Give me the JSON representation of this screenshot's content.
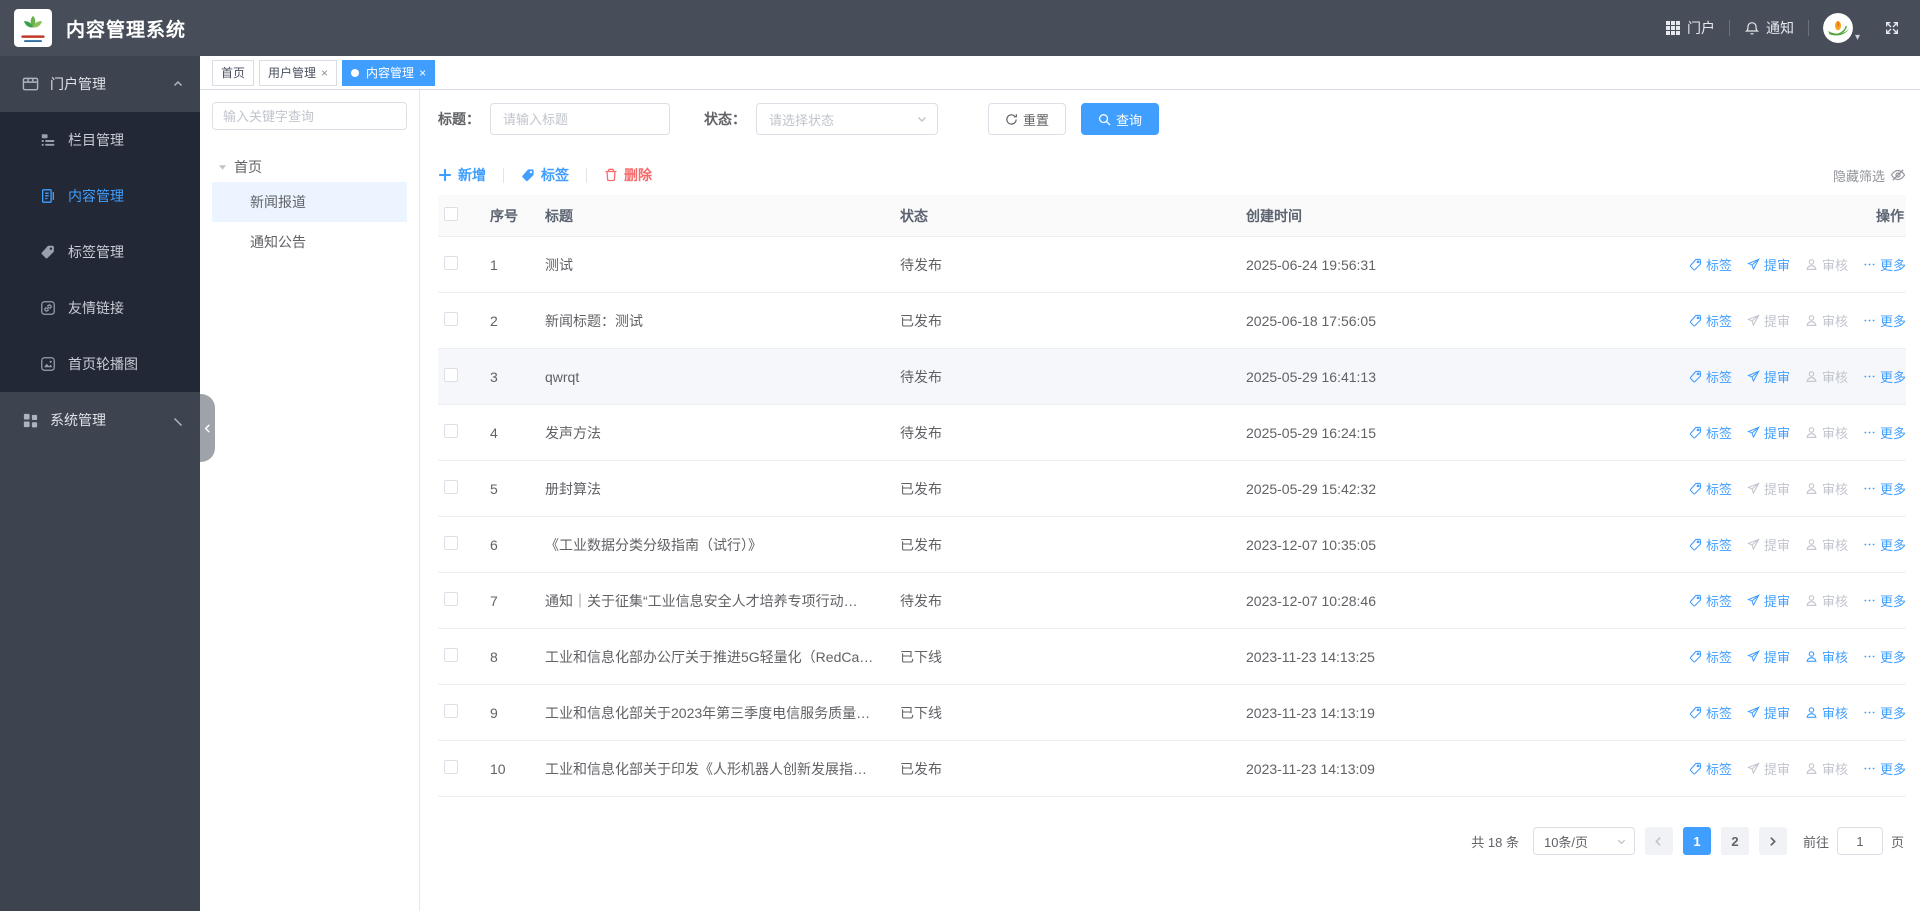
{
  "header": {
    "title": "内容管理系统",
    "portal": "门户",
    "notice": "通知"
  },
  "sidebar": {
    "groups": [
      {
        "label": "门户管理",
        "icon": "portal-icon",
        "state": "expanded",
        "children": [
          {
            "label": "栏目管理",
            "icon": "column-icon",
            "active": false
          },
          {
            "label": "内容管理",
            "icon": "content-icon",
            "active": true
          },
          {
            "label": "标签管理",
            "icon": "tag-icon",
            "active": false
          },
          {
            "label": "友情链接",
            "icon": "link-icon",
            "active": false
          },
          {
            "label": "首页轮播图",
            "icon": "carousel-icon",
            "active": false
          }
        ]
      },
      {
        "label": "系统管理",
        "icon": "system-icon",
        "state": "collapsed",
        "children": []
      }
    ]
  },
  "tabs": {
    "close_glyph": "×",
    "items": [
      {
        "label": "首页",
        "closable": false,
        "active": false
      },
      {
        "label": "用户管理",
        "closable": true,
        "active": false
      },
      {
        "label": "内容管理",
        "closable": true,
        "active": true
      }
    ]
  },
  "tree": {
    "search_placeholder": "输入关键字查询",
    "root": "首页",
    "children": [
      {
        "label": "新闻报道",
        "selected": true
      },
      {
        "label": "通知公告",
        "selected": false
      }
    ]
  },
  "filters": {
    "title_label": "标题：",
    "title_placeholder": "请输入标题",
    "status_label": "状态：",
    "status_placeholder": "请选择状态",
    "reset": "重置",
    "search": "查询"
  },
  "toolbar": {
    "add": "新增",
    "tag": "标签",
    "delete": "删除",
    "hide_filter": "隐藏筛选"
  },
  "table": {
    "columns": {
      "no": "序号",
      "title": "标题",
      "status": "状态",
      "created": "创建时间",
      "ops": "操作"
    },
    "ops_labels": {
      "tag": "标签",
      "submit": "提审",
      "audit": "审核",
      "more": "更多"
    },
    "rows": [
      {
        "no": "1",
        "title": "测试",
        "status": "待发布",
        "created": "2025-06-24 19:56:31",
        "submit_enabled": true,
        "audit_enabled": false,
        "highlight": false
      },
      {
        "no": "2",
        "title": "新闻标题：测试",
        "status": "已发布",
        "created": "2025-06-18 17:56:05",
        "submit_enabled": false,
        "audit_enabled": false,
        "highlight": false
      },
      {
        "no": "3",
        "title": "qwrqt",
        "status": "待发布",
        "created": "2025-05-29 16:41:13",
        "submit_enabled": true,
        "audit_enabled": false,
        "highlight": true
      },
      {
        "no": "4",
        "title": "发声方法",
        "status": "待发布",
        "created": "2025-05-29 16:24:15",
        "submit_enabled": true,
        "audit_enabled": false,
        "highlight": false
      },
      {
        "no": "5",
        "title": "册封算法",
        "status": "已发布",
        "created": "2025-05-29 15:42:32",
        "submit_enabled": false,
        "audit_enabled": false,
        "highlight": false
      },
      {
        "no": "6",
        "title": "《工业数据分类分级指南（试行）》",
        "status": "已发布",
        "created": "2023-12-07 10:35:05",
        "submit_enabled": false,
        "audit_enabled": false,
        "highlight": false
      },
      {
        "no": "7",
        "title": "通知｜关于征集“工业信息安全人才培养专项行动…",
        "status": "待发布",
        "created": "2023-12-07 10:28:46",
        "submit_enabled": true,
        "audit_enabled": false,
        "highlight": false
      },
      {
        "no": "8",
        "title": "工业和信息化部办公厅关于推进5G轻量化（RedCa…",
        "status": "已下线",
        "created": "2023-11-23 14:13:25",
        "submit_enabled": true,
        "audit_enabled": true,
        "highlight": false
      },
      {
        "no": "9",
        "title": "工业和信息化部关于2023年第三季度电信服务质量…",
        "status": "已下线",
        "created": "2023-11-23 14:13:19",
        "submit_enabled": true,
        "audit_enabled": true,
        "highlight": false
      },
      {
        "no": "10",
        "title": "工业和信息化部关于印发《人形机器人创新发展指…",
        "status": "已发布",
        "created": "2023-11-23 14:13:09",
        "submit_enabled": false,
        "audit_enabled": false,
        "highlight": false
      }
    ]
  },
  "pagination": {
    "total": "共 18 条",
    "page_size": "10条/页",
    "pages": [
      "1",
      "2"
    ],
    "active_page": "1",
    "goto_label": "前往",
    "goto_value": "1",
    "goto_unit": "页"
  },
  "colors": {
    "accent": "#409eff",
    "danger": "#f56c6c",
    "header_bg": "#474e5a",
    "sidebar_bg": "#3d4450",
    "submenu_bg": "#222835"
  }
}
